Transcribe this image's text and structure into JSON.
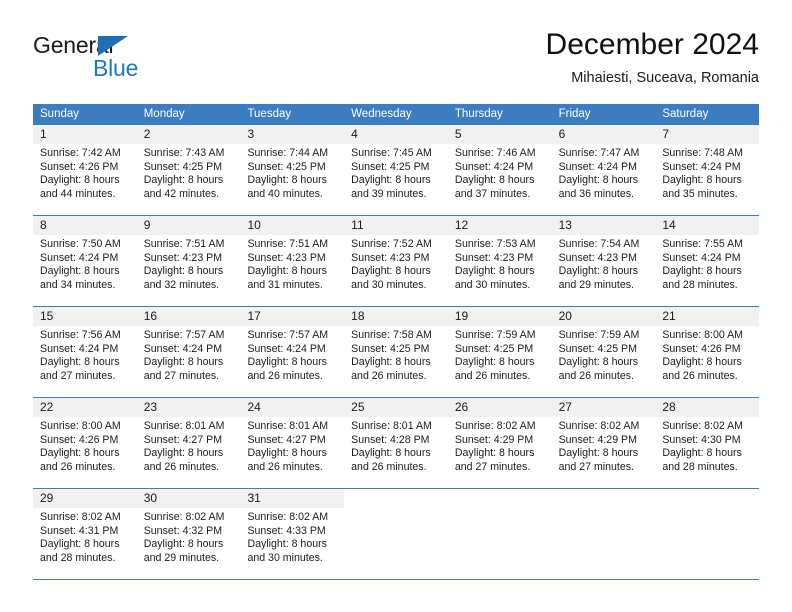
{
  "brand": {
    "name_part1": "General",
    "name_part2": "Blue",
    "triangle_color": "#1f6fb5",
    "blue_color": "#1b7ac4"
  },
  "header": {
    "title": "December 2024",
    "location": "Mihaiesti, Suceava, Romania"
  },
  "calendar": {
    "header_color": "#3b7dc0",
    "daynum_band_color": "#f1f1f1",
    "weekdays": [
      "Sunday",
      "Monday",
      "Tuesday",
      "Wednesday",
      "Thursday",
      "Friday",
      "Saturday"
    ],
    "weeks": [
      [
        {
          "day": "1",
          "lines": [
            "Sunrise: 7:42 AM",
            "Sunset: 4:26 PM",
            "Daylight: 8 hours",
            "and 44 minutes."
          ]
        },
        {
          "day": "2",
          "lines": [
            "Sunrise: 7:43 AM",
            "Sunset: 4:25 PM",
            "Daylight: 8 hours",
            "and 42 minutes."
          ]
        },
        {
          "day": "3",
          "lines": [
            "Sunrise: 7:44 AM",
            "Sunset: 4:25 PM",
            "Daylight: 8 hours",
            "and 40 minutes."
          ]
        },
        {
          "day": "4",
          "lines": [
            "Sunrise: 7:45 AM",
            "Sunset: 4:25 PM",
            "Daylight: 8 hours",
            "and 39 minutes."
          ]
        },
        {
          "day": "5",
          "lines": [
            "Sunrise: 7:46 AM",
            "Sunset: 4:24 PM",
            "Daylight: 8 hours",
            "and 37 minutes."
          ]
        },
        {
          "day": "6",
          "lines": [
            "Sunrise: 7:47 AM",
            "Sunset: 4:24 PM",
            "Daylight: 8 hours",
            "and 36 minutes."
          ]
        },
        {
          "day": "7",
          "lines": [
            "Sunrise: 7:48 AM",
            "Sunset: 4:24 PM",
            "Daylight: 8 hours",
            "and 35 minutes."
          ]
        }
      ],
      [
        {
          "day": "8",
          "lines": [
            "Sunrise: 7:50 AM",
            "Sunset: 4:24 PM",
            "Daylight: 8 hours",
            "and 34 minutes."
          ]
        },
        {
          "day": "9",
          "lines": [
            "Sunrise: 7:51 AM",
            "Sunset: 4:23 PM",
            "Daylight: 8 hours",
            "and 32 minutes."
          ]
        },
        {
          "day": "10",
          "lines": [
            "Sunrise: 7:51 AM",
            "Sunset: 4:23 PM",
            "Daylight: 8 hours",
            "and 31 minutes."
          ]
        },
        {
          "day": "11",
          "lines": [
            "Sunrise: 7:52 AM",
            "Sunset: 4:23 PM",
            "Daylight: 8 hours",
            "and 30 minutes."
          ]
        },
        {
          "day": "12",
          "lines": [
            "Sunrise: 7:53 AM",
            "Sunset: 4:23 PM",
            "Daylight: 8 hours",
            "and 30 minutes."
          ]
        },
        {
          "day": "13",
          "lines": [
            "Sunrise: 7:54 AM",
            "Sunset: 4:23 PM",
            "Daylight: 8 hours",
            "and 29 minutes."
          ]
        },
        {
          "day": "14",
          "lines": [
            "Sunrise: 7:55 AM",
            "Sunset: 4:24 PM",
            "Daylight: 8 hours",
            "and 28 minutes."
          ]
        }
      ],
      [
        {
          "day": "15",
          "lines": [
            "Sunrise: 7:56 AM",
            "Sunset: 4:24 PM",
            "Daylight: 8 hours",
            "and 27 minutes."
          ]
        },
        {
          "day": "16",
          "lines": [
            "Sunrise: 7:57 AM",
            "Sunset: 4:24 PM",
            "Daylight: 8 hours",
            "and 27 minutes."
          ]
        },
        {
          "day": "17",
          "lines": [
            "Sunrise: 7:57 AM",
            "Sunset: 4:24 PM",
            "Daylight: 8 hours",
            "and 26 minutes."
          ]
        },
        {
          "day": "18",
          "lines": [
            "Sunrise: 7:58 AM",
            "Sunset: 4:25 PM",
            "Daylight: 8 hours",
            "and 26 minutes."
          ]
        },
        {
          "day": "19",
          "lines": [
            "Sunrise: 7:59 AM",
            "Sunset: 4:25 PM",
            "Daylight: 8 hours",
            "and 26 minutes."
          ]
        },
        {
          "day": "20",
          "lines": [
            "Sunrise: 7:59 AM",
            "Sunset: 4:25 PM",
            "Daylight: 8 hours",
            "and 26 minutes."
          ]
        },
        {
          "day": "21",
          "lines": [
            "Sunrise: 8:00 AM",
            "Sunset: 4:26 PM",
            "Daylight: 8 hours",
            "and 26 minutes."
          ]
        }
      ],
      [
        {
          "day": "22",
          "lines": [
            "Sunrise: 8:00 AM",
            "Sunset: 4:26 PM",
            "Daylight: 8 hours",
            "and 26 minutes."
          ]
        },
        {
          "day": "23",
          "lines": [
            "Sunrise: 8:01 AM",
            "Sunset: 4:27 PM",
            "Daylight: 8 hours",
            "and 26 minutes."
          ]
        },
        {
          "day": "24",
          "lines": [
            "Sunrise: 8:01 AM",
            "Sunset: 4:27 PM",
            "Daylight: 8 hours",
            "and 26 minutes."
          ]
        },
        {
          "day": "25",
          "lines": [
            "Sunrise: 8:01 AM",
            "Sunset: 4:28 PM",
            "Daylight: 8 hours",
            "and 26 minutes."
          ]
        },
        {
          "day": "26",
          "lines": [
            "Sunrise: 8:02 AM",
            "Sunset: 4:29 PM",
            "Daylight: 8 hours",
            "and 27 minutes."
          ]
        },
        {
          "day": "27",
          "lines": [
            "Sunrise: 8:02 AM",
            "Sunset: 4:29 PM",
            "Daylight: 8 hours",
            "and 27 minutes."
          ]
        },
        {
          "day": "28",
          "lines": [
            "Sunrise: 8:02 AM",
            "Sunset: 4:30 PM",
            "Daylight: 8 hours",
            "and 28 minutes."
          ]
        }
      ],
      [
        {
          "day": "29",
          "lines": [
            "Sunrise: 8:02 AM",
            "Sunset: 4:31 PM",
            "Daylight: 8 hours",
            "and 28 minutes."
          ]
        },
        {
          "day": "30",
          "lines": [
            "Sunrise: 8:02 AM",
            "Sunset: 4:32 PM",
            "Daylight: 8 hours",
            "and 29 minutes."
          ]
        },
        {
          "day": "31",
          "lines": [
            "Sunrise: 8:02 AM",
            "Sunset: 4:33 PM",
            "Daylight: 8 hours",
            "and 30 minutes."
          ]
        },
        {
          "day": "",
          "lines": []
        },
        {
          "day": "",
          "lines": []
        },
        {
          "day": "",
          "lines": []
        },
        {
          "day": "",
          "lines": []
        }
      ]
    ]
  }
}
